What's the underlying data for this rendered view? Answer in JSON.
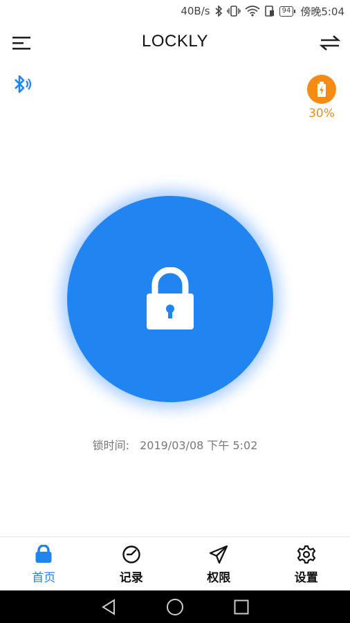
{
  "status_bar": {
    "network_speed": "40B/s",
    "battery_level": "94",
    "time": "傍晚5:04"
  },
  "header": {
    "title": "LOCKLY"
  },
  "device": {
    "battery_percent": "30%"
  },
  "lock": {
    "state": "locked",
    "time_label": "锁时间:",
    "time_value": "2019/03/08 下午 5:02"
  },
  "bottom_nav": {
    "items": [
      {
        "label": "首页",
        "icon": "home-icon",
        "active": true
      },
      {
        "label": "记录",
        "icon": "clock-icon",
        "active": false
      },
      {
        "label": "权限",
        "icon": "paper-plane-icon",
        "active": false
      },
      {
        "label": "设置",
        "icon": "gear-icon",
        "active": false
      }
    ]
  },
  "colors": {
    "accent": "#2085f1",
    "battery_orange": "#f58b13",
    "system_nav_bg": "#000000"
  }
}
